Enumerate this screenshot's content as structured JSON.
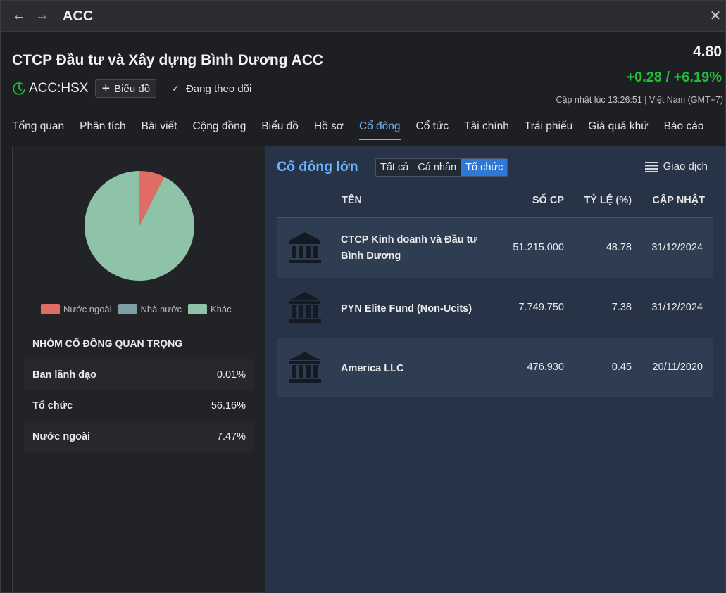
{
  "window": {
    "title": "ACC"
  },
  "header": {
    "company_name": "CTCP Đầu tư và Xây dựng Bình Dương ACC",
    "ticker": "ACC:HSX",
    "chart_button": "Biểu đồ",
    "follow_label": "Đang theo dõi",
    "price": "4.80",
    "change": "+0.28 / +6.19%",
    "updated": "Cập nhật lúc  13:26:51 | Việt Nam (GMT+7)"
  },
  "tabs": [
    {
      "label": "Tổng quan"
    },
    {
      "label": "Phân tích"
    },
    {
      "label": "Bài viết"
    },
    {
      "label": "Cộng đồng"
    },
    {
      "label": "Biểu đồ"
    },
    {
      "label": "Hồ sơ"
    },
    {
      "label": "Cổ đông"
    },
    {
      "label": "Cổ tức"
    },
    {
      "label": "Tài chính"
    },
    {
      "label": "Trái phiếu"
    },
    {
      "label": "Giá quá khứ"
    },
    {
      "label": "Báo cáo"
    }
  ],
  "active_tab": "Cổ đông",
  "chart_data": {
    "type": "pie",
    "series": [
      {
        "name": "Nước ngoài",
        "value": 7.47,
        "color": "#e06c66"
      },
      {
        "name": "Nhà nước",
        "value": 0,
        "color": "#7e9ea3"
      },
      {
        "name": "Khác",
        "value": 92.53,
        "color": "#8ec3a8"
      }
    ]
  },
  "legend": [
    {
      "label": "Nước ngoài",
      "color": "#e06c66"
    },
    {
      "label": "Nhà nước",
      "color": "#7e9ea3"
    },
    {
      "label": "Khác",
      "color": "#8ec3a8"
    }
  ],
  "groups": {
    "title": "NHÓM CỔ ĐÔNG QUAN TRỌNG",
    "rows": [
      {
        "label": "Ban lãnh đạo",
        "value": "0.01%"
      },
      {
        "label": "Tổ chức",
        "value": "56.16%"
      },
      {
        "label": "Nước ngoài",
        "value": "7.47%"
      }
    ]
  },
  "major": {
    "title": "Cổ đông lớn",
    "filters": [
      "Tất cả",
      "Cá nhân",
      "Tổ chức"
    ],
    "active_filter": "Tổ chức",
    "transactions_label": "Giao dịch",
    "headers": {
      "name": "TÊN",
      "shares": "SỐ CP",
      "pct": "TỶ LỆ (%)",
      "updated": "CẬP NHẬT"
    },
    "rows": [
      {
        "icon": "bank-icon",
        "name": "CTCP Kinh doanh và Đầu tư Bình Dương",
        "shares": "51.215.000",
        "pct": "48.78",
        "date": "31/12/2024"
      },
      {
        "icon": "bank-icon",
        "name": "PYN Elite Fund (Non-Ucits)",
        "shares": "7.749.750",
        "pct": "7.38",
        "date": "31/12/2024"
      },
      {
        "icon": "bank-icon",
        "name": "America LLC",
        "shares": "476.930",
        "pct": "0.45",
        "date": "20/11/2020"
      }
    ]
  },
  "colors": {
    "accent": "#6fb2ff",
    "positive": "#1fbf3a",
    "filter_active": "#2e78d6"
  }
}
